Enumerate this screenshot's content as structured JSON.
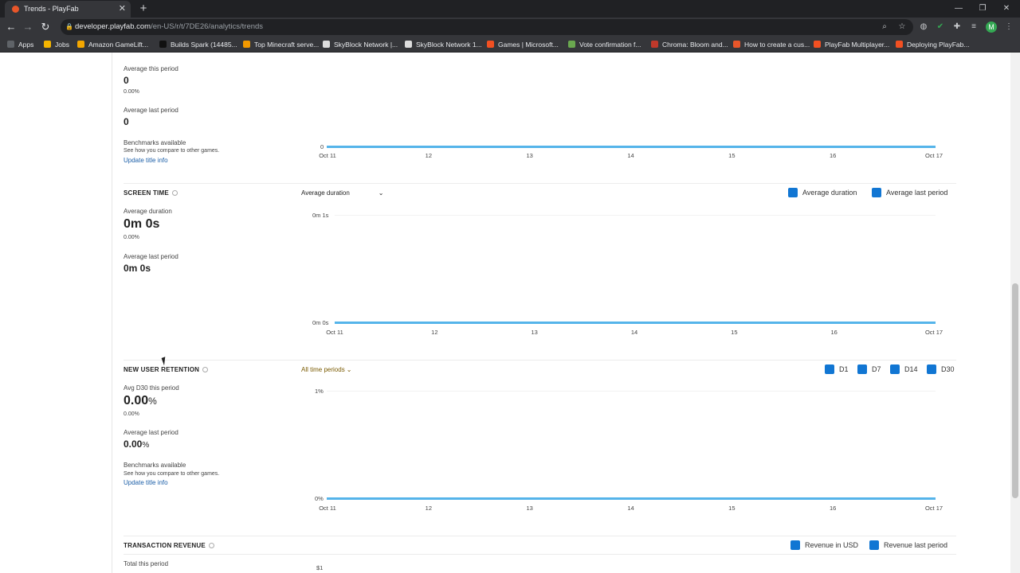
{
  "browser": {
    "tab_title": "Trends - PlayFab",
    "url_host": "developer.playfab.com",
    "url_path": "/en-US/r/t/7DE26/analytics/trends",
    "avatar_letter": "M",
    "bookmarks": [
      {
        "label": "Apps",
        "color": "#5f6368"
      },
      {
        "label": "Jobs",
        "color": "#f4b400"
      },
      {
        "label": "Amazon GameLift...",
        "color": "#f4a700"
      },
      {
        "label": "Builds Spark (14485...",
        "color": "#111111"
      },
      {
        "label": "Top Minecraft serve...",
        "color": "#f29900"
      },
      {
        "label": "SkyBlock Network |...",
        "color": "#dddddd"
      },
      {
        "label": "SkyBlock Network 1...",
        "color": "#dddddd"
      },
      {
        "label": "Games | Microsoft...",
        "color": "#f25022"
      },
      {
        "label": "Vote confirmation f...",
        "color": "#6aa84f"
      },
      {
        "label": "Chroma: Bloom and...",
        "color": "#c0392b"
      },
      {
        "label": "How to create a cus...",
        "color": "#e8562a"
      },
      {
        "label": "PlayFab Multiplayer...",
        "color": "#f25022"
      },
      {
        "label": "Deploying PlayFab...",
        "color": "#f25022"
      }
    ]
  },
  "top_section": {
    "avg_this_label": "Average this period",
    "avg_this_value": "0",
    "avg_this_pct": "0.00%",
    "avg_last_label": "Average last period",
    "avg_last_value": "0",
    "bench_title": "Benchmarks available",
    "bench_sub": "See how you compare to other games.",
    "bench_link": "Update title info",
    "y_zero": "0",
    "x_labels": [
      "Oct 11",
      "12",
      "13",
      "14",
      "15",
      "16",
      "Oct 17"
    ]
  },
  "screen_time": {
    "title": "SCREEN TIME",
    "dropdown": "Average duration",
    "legend": [
      "Average duration",
      "Average last period"
    ],
    "avg_label": "Average duration",
    "avg_value": "0m 0s",
    "avg_pct": "0.00%",
    "last_label": "Average last period",
    "last_value": "0m 0s",
    "y_top": "0m 1s",
    "y_bottom": "0m 0s",
    "x_labels": [
      "Oct 11",
      "12",
      "13",
      "14",
      "15",
      "16",
      "Oct 17"
    ]
  },
  "retention": {
    "title": "NEW USER RETENTION",
    "dropdown": "All time periods",
    "legend": [
      "D1",
      "D7",
      "D14",
      "D30"
    ],
    "avg_label": "Avg D30 this period",
    "avg_value": "0.00",
    "avg_unit": "%",
    "avg_pct": "0.00%",
    "last_label": "Average last period",
    "last_value": "0.00",
    "last_unit": "%",
    "bench_title": "Benchmarks available",
    "bench_sub": "See how you compare to other games.",
    "bench_link": "Update title info",
    "y_top": "1%",
    "y_bottom": "0%",
    "x_labels": [
      "Oct 11",
      "12",
      "13",
      "14",
      "15",
      "16",
      "Oct 17"
    ]
  },
  "revenue": {
    "title": "TRANSACTION REVENUE",
    "legend": [
      "Revenue in USD",
      "Revenue last period"
    ],
    "total_label": "Total this period",
    "y_top": "$1"
  }
}
